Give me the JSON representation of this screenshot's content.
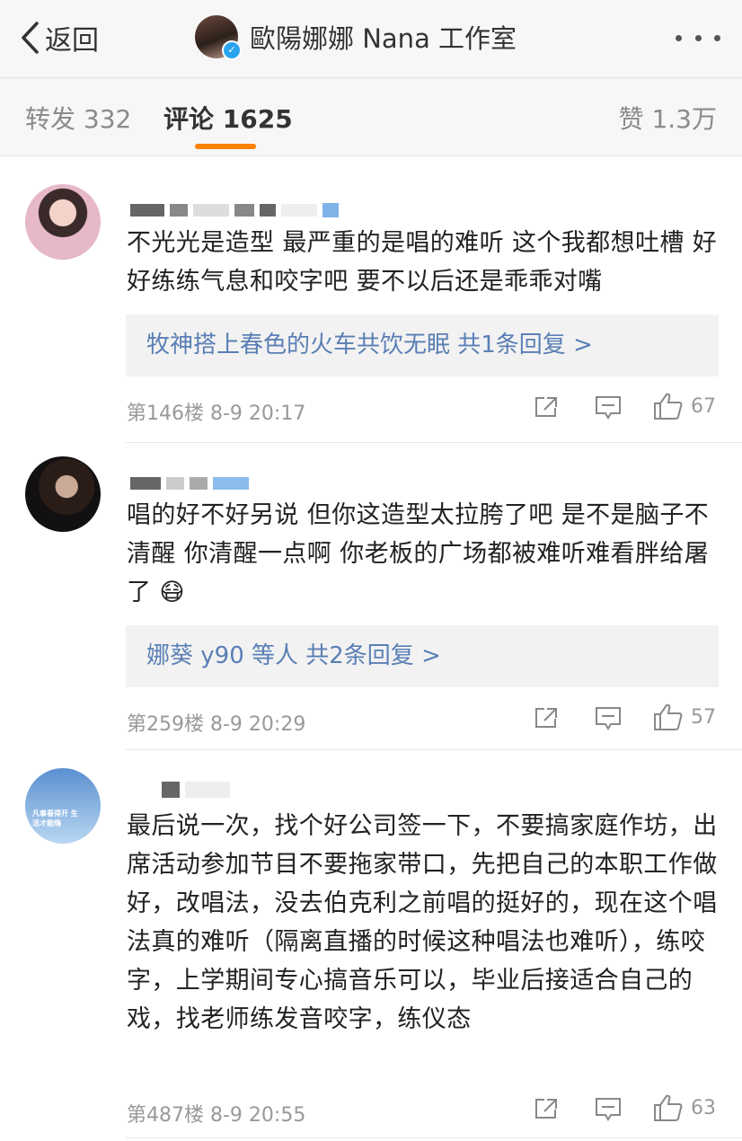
{
  "header": {
    "back_label": "返回",
    "title": "歐陽娜娜 Nana 工作室"
  },
  "tabs": {
    "repost": "转发 332",
    "comments": "评论 1625",
    "likes": "赞 1.3万"
  },
  "comments": [
    {
      "text": "不光光是造型 最严重的是唱的难听 这个我都想吐槽 好好练练气息和咬字吧 要不以后还是乖乖对嘴",
      "reply": "牧神搭上春色的火车共饮无眠  共1条回复 >",
      "meta": "第146楼 8-9 20:17",
      "likes": "67"
    },
    {
      "text": "唱的好不好另说  但你这造型太拉胯了吧  是不是脑子不清醒  你清醒一点啊  你老板的广场都被难听难看胖给屠了",
      "emoji": "😷",
      "reply": "娜葵 y90 等人  共2条回复 >",
      "meta": "第259楼 8-9 20:29",
      "likes": "57"
    },
    {
      "text": "最后说一次，找个好公司签一下，不要搞家庭作坊，出席活动参加节目不要拖家带口，先把自己的本职工作做好，改唱法，没去伯克利之前唱的挺好的，现在这个唱法真的难听（隔离直播的时候这种唱法也难听），练咬字，上学期间专心搞音乐可以，毕业后接适合自己的戏，找老师练发音咬字，练仪态",
      "avatar_text": "凡事看得开 生活才能嗨",
      "meta": "第487楼 8-9 20:55",
      "likes": "63"
    }
  ],
  "colors": {
    "accent": "#ff8200",
    "link": "#5a7fb5",
    "meta": "#999999"
  }
}
